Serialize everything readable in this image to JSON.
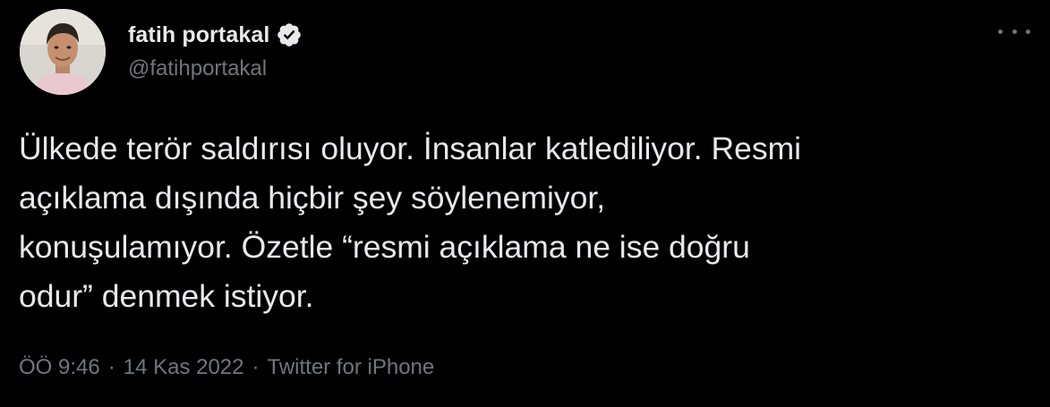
{
  "author": {
    "display_name": "fatih portakal",
    "handle": "@fatihportakal",
    "avatar_icon": "avatar-photo",
    "verified_icon": "verified-badge-icon"
  },
  "tweet": {
    "text": "Ülkede terör saldırısı oluyor. İnsanlar katlediliyor. Resmi\naçıklama dışında hiçbir şey söylenemiyor,\nkonuşulamıyor. Özetle “resmi açıklama ne ise doğru\nodur” denmek istiyor."
  },
  "meta": {
    "time": "ÖÖ 9:46",
    "separator": "·",
    "date": "14 Kas 2022",
    "source": "Twitter for iPhone"
  },
  "colors": {
    "background": "#000000",
    "primary_text": "#e7e9ea",
    "secondary_text": "#71767b"
  }
}
